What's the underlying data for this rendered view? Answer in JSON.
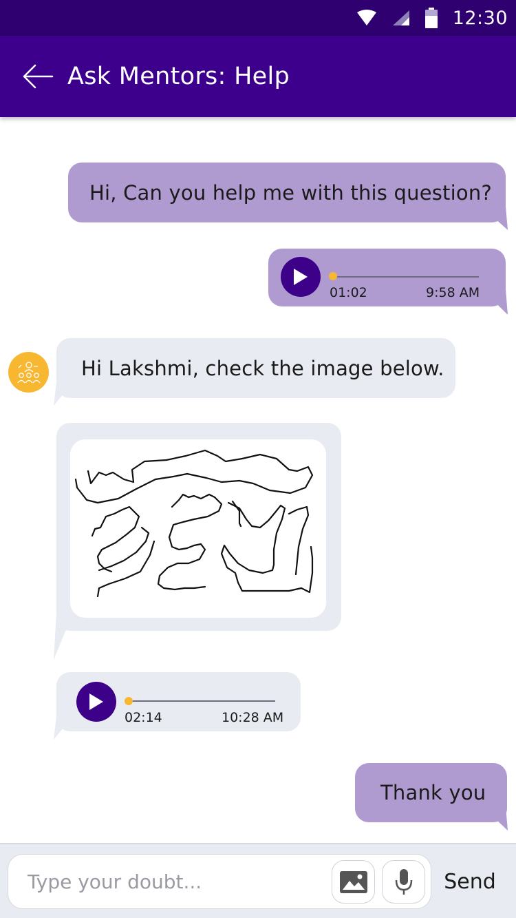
{
  "status_bar": {
    "time": "12:30",
    "icons": [
      "wifi-icon",
      "signal-icon",
      "battery-icon"
    ]
  },
  "app_bar": {
    "title": "Ask Mentors: Help",
    "back_icon": "arrow-left-icon"
  },
  "messages": [
    {
      "type": "text",
      "from": "me",
      "text": "Hi, Can you help me with this question?"
    },
    {
      "type": "audio",
      "from": "me",
      "duration": "01:02",
      "time": "9:58 AM",
      "progress": 0
    },
    {
      "type": "text",
      "from": "mentor",
      "text": "Hi Lakshmi, check the image below."
    },
    {
      "type": "image",
      "from": "mentor",
      "content": "handwritten-sketch"
    },
    {
      "type": "audio",
      "from": "mentor",
      "duration": "02:14",
      "time": "10:28 AM",
      "progress": 0
    },
    {
      "type": "text",
      "from": "me",
      "text": "Thank you"
    }
  ],
  "input": {
    "placeholder": "Type your doubt...",
    "image_icon": "image-icon",
    "mic_icon": "microphone-icon",
    "send_label": "Send"
  },
  "colors": {
    "status_bar": "#2e0070",
    "app_bar": "#3d008c",
    "sent_bubble": "#b09bd1",
    "received_bubble": "#e8ebf1",
    "play_button": "#3d0088",
    "accent_dot": "#f7b731",
    "avatar": "#f7b731"
  }
}
